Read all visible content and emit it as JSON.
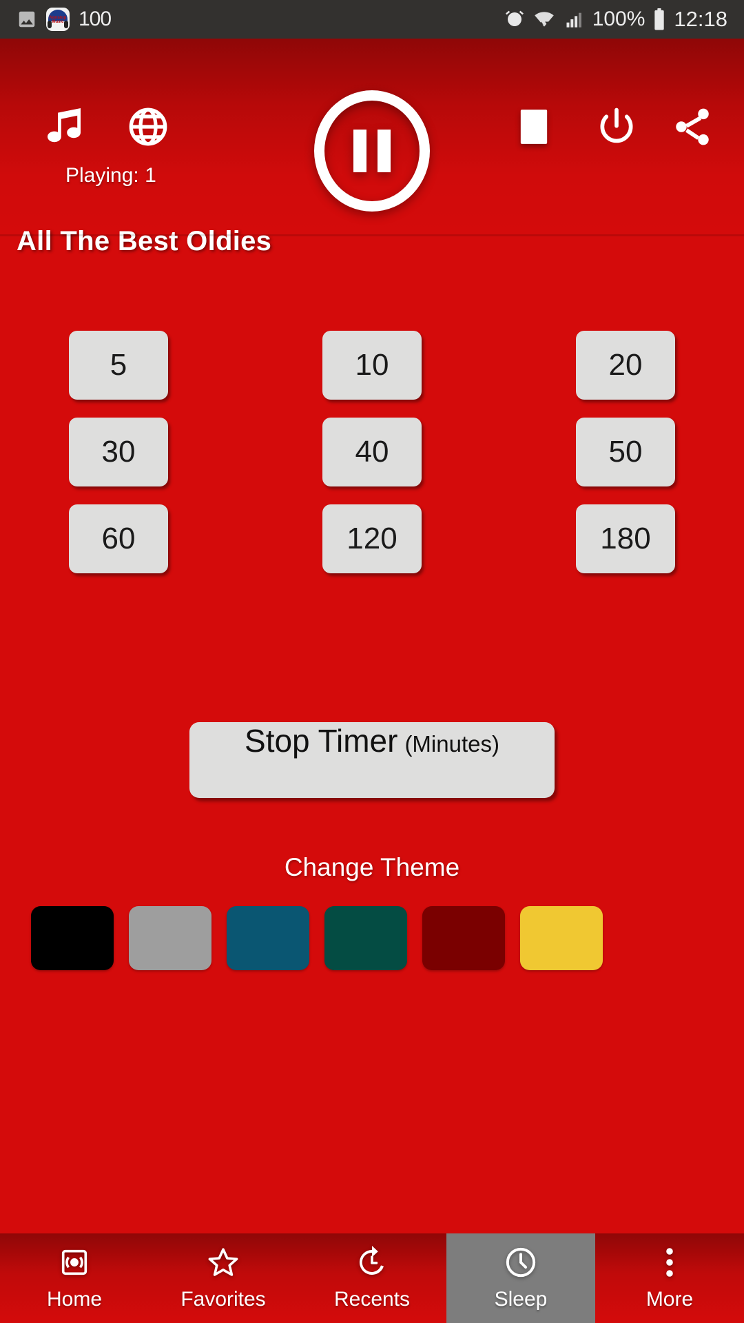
{
  "statusbar": {
    "app_badge_line1": "Nonstop",
    "app_badge_line2": "Music",
    "notification_count": "100",
    "battery_percent": "100%",
    "clock": "12:18",
    "icons": [
      "image-icon",
      "app-notification-icon",
      "alarm-icon",
      "wifi-icon",
      "signal-icon",
      "battery-icon"
    ]
  },
  "player": {
    "playing_label": "Playing: 1",
    "station_title": "All The Best Oldies",
    "transport_state": "playing",
    "controls": [
      {
        "name": "music-note-icon",
        "label": "Music"
      },
      {
        "name": "globe-icon",
        "label": "Web"
      },
      {
        "name": "pause-button",
        "label": "Pause"
      },
      {
        "name": "stop-button",
        "label": "Stop"
      },
      {
        "name": "power-button",
        "label": "Power"
      },
      {
        "name": "share-button",
        "label": "Share"
      }
    ]
  },
  "sleep_timer": {
    "options": [
      "5",
      "10",
      "20",
      "30",
      "40",
      "50",
      "60",
      "120",
      "180"
    ],
    "stop_main": "Stop Timer",
    "stop_sub": "(Minutes)"
  },
  "theme": {
    "label": "Change Theme",
    "swatches": [
      {
        "name": "theme-black",
        "color": "#000000"
      },
      {
        "name": "theme-gray",
        "color": "#9e9e9e"
      },
      {
        "name": "theme-blue",
        "color": "#0a5672"
      },
      {
        "name": "theme-green",
        "color": "#044c43"
      },
      {
        "name": "theme-maroon",
        "color": "#7a0000"
      },
      {
        "name": "theme-yellow",
        "color": "#f0c832"
      }
    ]
  },
  "nav": {
    "active_index": 3,
    "items": [
      {
        "label": "Home",
        "icon": "radio-icon"
      },
      {
        "label": "Favorites",
        "icon": "star-icon"
      },
      {
        "label": "Recents",
        "icon": "history-icon"
      },
      {
        "label": "Sleep",
        "icon": "clock-icon"
      },
      {
        "label": "More",
        "icon": "overflow-menu-icon"
      }
    ]
  },
  "colors": {
    "background_red": "#d40b0b",
    "panel_dark_red": "#8f0707",
    "statusbar": "#33312f",
    "button_face": "#dededd",
    "active_nav": "#7d7d7d"
  }
}
